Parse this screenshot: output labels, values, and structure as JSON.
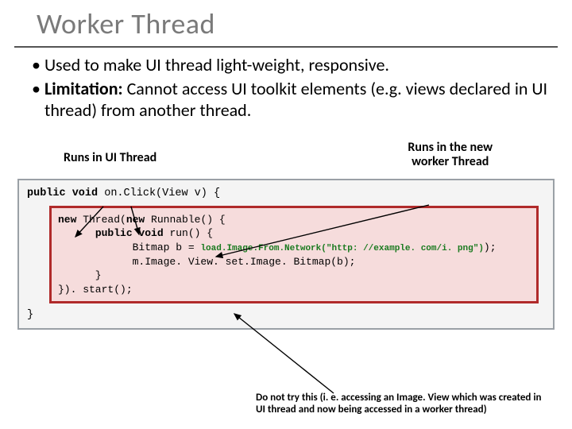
{
  "title": "Worker Thread",
  "bullets": {
    "b1": "Used to make UI thread light-weight, responsive.",
    "b2_strong": "Limitation:",
    "b2_rest": " Cannot access UI toolkit elements (e.g. views declared in UI thread) from another thread."
  },
  "labels": {
    "left": "Runs in UI Thread",
    "right": "Runs in the new\nworker Thread"
  },
  "code": {
    "outer_open": "public void on.Click(View v) {",
    "inner_l1": "new Thread(new Runnable() {",
    "inner_l2": "      public void run() {",
    "inner_l3_pre": "            Bitmap b = ",
    "inner_l3_call": "load.Image.From.Network(",
    "inner_l3_str": "\"http: //example. com/i. png\"",
    "inner_l3_post": ");",
    "inner_l4": "            m.Image. View. set.Image. Bitmap(b);",
    "inner_l5": "      }",
    "inner_l6": "}). start();",
    "outer_close": "}"
  },
  "footnote": "Do not try this (i. e. accessing an Image. View which was created in UI thread and now being accessed in a worker thread)"
}
